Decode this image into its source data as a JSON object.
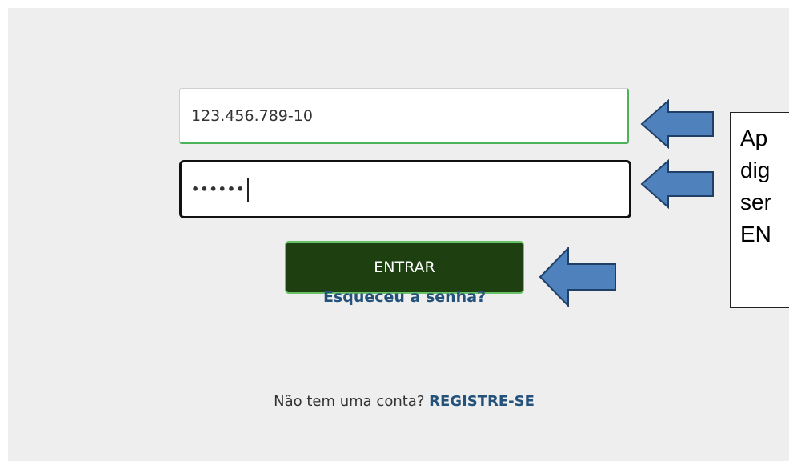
{
  "login": {
    "value": "123.456.789-10"
  },
  "password": {
    "masked_value": "••••••"
  },
  "buttons": {
    "entrar_label": "ENTRAR"
  },
  "links": {
    "forgot_password": "Esqueceu a senha?",
    "no_account_text": "Não tem uma conta?",
    "register": "REGISTRE-SE"
  },
  "callout": {
    "lines": [
      "Ap",
      "dig",
      "ser",
      "EN"
    ]
  },
  "colors": {
    "background": "#eeeeee",
    "button_bg": "#1e4010",
    "button_border": "#69c167",
    "link": "#24527a",
    "focus_border": "#111111",
    "valid_border": "#4cb35a",
    "arrow_fill": "#4f81bd",
    "arrow_stroke": "#1f3f66"
  },
  "icons": {
    "pointer_arrow": "left-arrow-icon"
  }
}
